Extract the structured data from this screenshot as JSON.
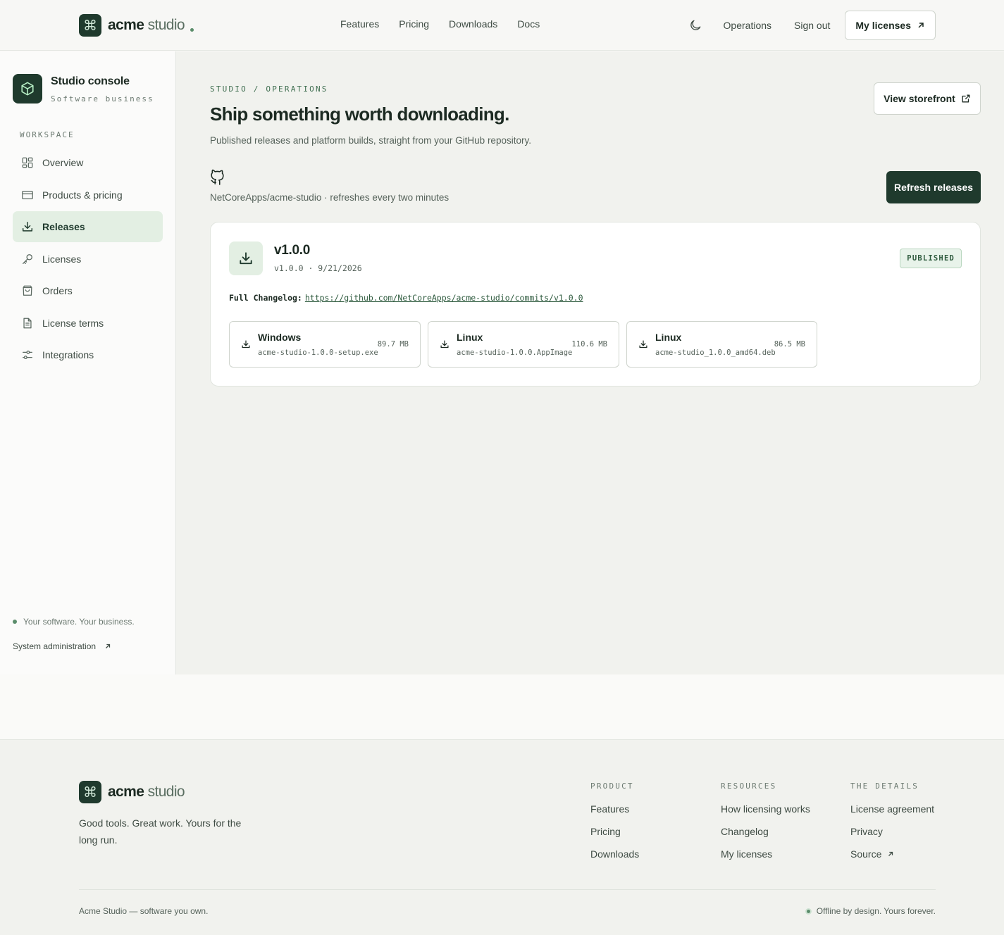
{
  "topnav": {
    "brand_bold": "acme",
    "brand_light": "studio",
    "links": [
      "Features",
      "Pricing",
      "Downloads",
      "Docs"
    ],
    "operations": "Operations",
    "sign_out": "Sign out",
    "my_licenses": "My licenses"
  },
  "sidebar": {
    "title": "Studio console",
    "subtitle": "Software business",
    "section_label": "WORKSPACE",
    "items": [
      {
        "label": "Overview",
        "icon": "grid-icon"
      },
      {
        "label": "Products & pricing",
        "icon": "card-icon"
      },
      {
        "label": "Releases",
        "icon": "download-icon",
        "active": true
      },
      {
        "label": "Licenses",
        "icon": "key-icon"
      },
      {
        "label": "Orders",
        "icon": "bag-icon"
      },
      {
        "label": "License terms",
        "icon": "document-icon"
      },
      {
        "label": "Integrations",
        "icon": "sliders-icon"
      }
    ],
    "footer_tagline": "Your software. Your business.",
    "footer_link": "System administration"
  },
  "main": {
    "breadcrumb": "STUDIO / OPERATIONS",
    "title": "Ship something worth downloading.",
    "description": "Published releases and platform builds, straight from your GitHub repository.",
    "storefront_button": "View storefront",
    "repo_line": "NetCoreApps/acme-studio · refreshes every two minutes",
    "refresh_button": "Refresh releases"
  },
  "release": {
    "version": "v1.0.0",
    "meta": "v1.0.0 · 9/21/2026",
    "status": "PUBLISHED",
    "changelog_label": "Full Changelog:",
    "changelog_url": "https://github.com/NetCoreApps/acme-studio/commits/v1.0.0",
    "assets": [
      {
        "os": "Windows",
        "file": "acme-studio-1.0.0-setup.exe",
        "size": "89.7 MB"
      },
      {
        "os": "Linux",
        "file": "acme-studio-1.0.0.AppImage",
        "size": "110.6 MB"
      },
      {
        "os": "Linux",
        "file": "acme-studio_1.0.0_amd64.deb",
        "size": "86.5 MB"
      }
    ]
  },
  "footer": {
    "brand_bold": "acme",
    "brand_light": "studio",
    "tagline": "Good tools. Great work. Yours for the long run.",
    "columns": [
      {
        "heading": "PRODUCT",
        "links": [
          "Features",
          "Pricing",
          "Downloads"
        ]
      },
      {
        "heading": "RESOURCES",
        "links": [
          "How licensing works",
          "Changelog",
          "My licenses"
        ]
      },
      {
        "heading": "THE DETAILS",
        "links": [
          "License agreement",
          "Privacy",
          "Source"
        ]
      }
    ],
    "copyright": "Acme Studio — software you own.",
    "status": "Offline by design. Yours forever."
  },
  "colors": {
    "brand_dark": "#1f3a2d",
    "accent_green": "#5b8d6b",
    "active_bg": "#e3efe3"
  }
}
